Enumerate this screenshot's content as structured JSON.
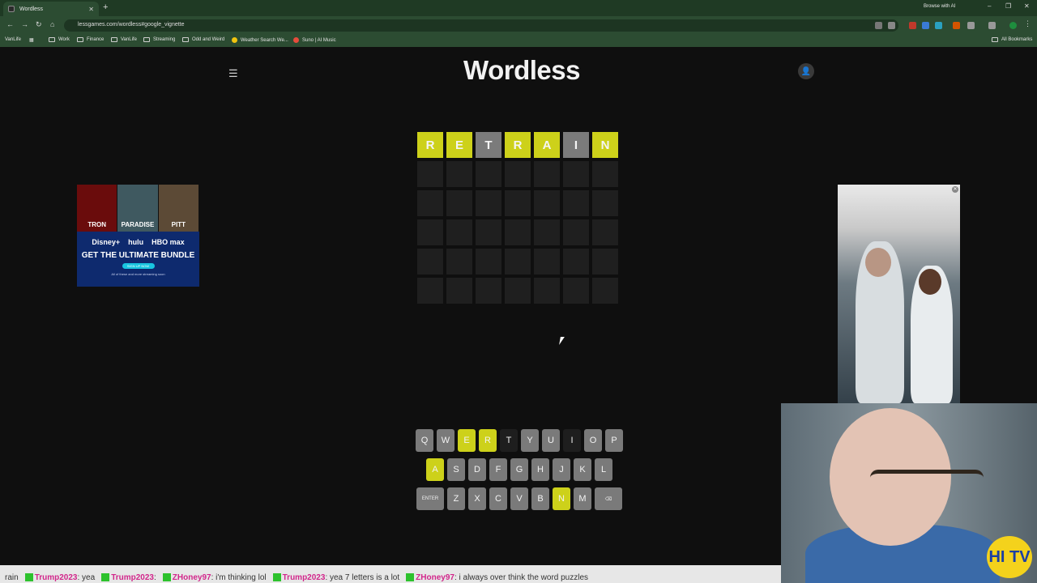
{
  "browser": {
    "tab_title": "Wordless",
    "new_tab": "+",
    "url": "lessgames.com/wordless#google_vignette",
    "browse_ai": "Browse with AI",
    "all_bookmarks": "All Bookmarks",
    "bookmarks": [
      "VanLife",
      "Work",
      "Finance",
      "VanLife",
      "Streaming",
      "Odd and Weird",
      "Weather Search We...",
      "Suno | AI Music"
    ]
  },
  "page": {
    "logo": "Wordless",
    "board": [
      [
        "R",
        "E",
        "T",
        "R",
        "A",
        "I",
        "N"
      ],
      [
        "",
        "",
        "",
        "",
        "",
        "",
        ""
      ],
      [
        "",
        "",
        "",
        "",
        "",
        "",
        ""
      ],
      [
        "",
        "",
        "",
        "",
        "",
        "",
        ""
      ],
      [
        "",
        "",
        "",
        "",
        "",
        "",
        ""
      ],
      [
        "",
        "",
        "",
        "",
        "",
        "",
        ""
      ]
    ],
    "board_states": [
      [
        "present",
        "present",
        "absent",
        "present",
        "present",
        "absent",
        "present"
      ]
    ],
    "keyboard": {
      "row1": [
        "Q",
        "W",
        "E",
        "R",
        "T",
        "Y",
        "U",
        "I",
        "O",
        "P"
      ],
      "row2": [
        "A",
        "S",
        "D",
        "F",
        "G",
        "H",
        "J",
        "K",
        "L"
      ],
      "row3": [
        "ENTER",
        "Z",
        "X",
        "C",
        "V",
        "B",
        "N",
        "M",
        "⌫"
      ],
      "present": [
        "E",
        "R",
        "A",
        "N"
      ],
      "absent": [
        "T",
        "I"
      ]
    }
  },
  "ads": {
    "left": {
      "posters": [
        "TRON",
        "PARADISE",
        "PITT"
      ],
      "brands": [
        "Disney+",
        "hulu",
        "HBO max"
      ],
      "headline": "GET THE ULTIMATE BUNDLE",
      "cta": "SIGN UP NOW",
      "fine": "All of these and more streaming soon"
    }
  },
  "stream": {
    "badge": "HI TV",
    "chat": [
      {
        "text": "rain"
      },
      {
        "user": "Trump2023",
        "text": ": yea"
      },
      {
        "user": "Trump2023",
        "text": ":"
      },
      {
        "user": "ZHoney97",
        "text": ": i'm thinking lol"
      },
      {
        "user": "Trump2023",
        "text": ": yea 7 letters is a lot"
      },
      {
        "user": "ZHoney97",
        "text": ": i always over think the word puzzles"
      }
    ]
  },
  "colors": {
    "present": "#cdd11a",
    "absent": "#7b7b7b",
    "empty": "#1f1f1f",
    "background": "#0f0f0f"
  }
}
